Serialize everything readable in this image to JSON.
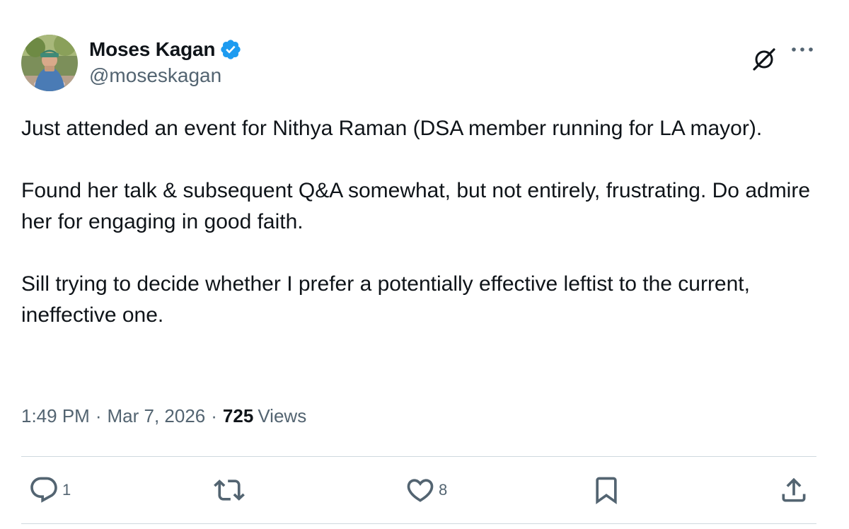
{
  "author": {
    "display_name": "Moses Kagan",
    "handle": "@moseskagan",
    "verified": true,
    "verified_color": "#1d9bf0"
  },
  "tweet": {
    "paragraphs": [
      "Just attended an event for Nithya Raman (DSA member running for LA mayor).",
      "Found her talk & subsequent Q&A somewhat, but not entirely, frustrating. Do admire her for engaging in good faith.",
      "Sill trying to decide whether I prefer a potentially effective leftist to the current, ineffective one."
    ],
    "time": "1:49 PM",
    "date": "Mar 7, 2026",
    "views_count": "725",
    "views_label": "Views"
  },
  "actions": {
    "reply_count": "1",
    "like_count": "8"
  },
  "icons": {
    "grok": "grok-icon",
    "more": "more-icon",
    "reply": "reply-icon",
    "retweet": "retweet-icon",
    "like": "heart-icon",
    "bookmark": "bookmark-icon",
    "share": "share-icon"
  },
  "colors": {
    "text_primary": "#0f1419",
    "text_secondary": "#536471",
    "divider": "#cfd9de"
  }
}
